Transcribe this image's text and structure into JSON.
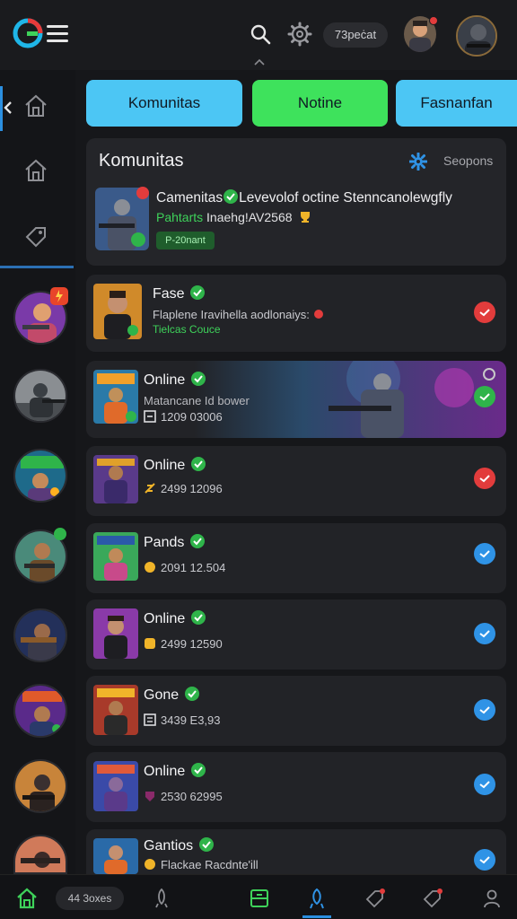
{
  "topbar": {
    "status_pill": "73peċat"
  },
  "tabs": [
    {
      "label": "Komunitas",
      "color": "#4cc6f4"
    },
    {
      "label": "Notine",
      "color": "#3ee25c"
    },
    {
      "label": "Fasnanfan",
      "color": "#4cc6f4"
    }
  ],
  "header_card": {
    "title": "Komunitas",
    "options_label": "Seopons",
    "headline": "Camenitas",
    "headline_rest": "Levevolof octine Stenncanolewgfly",
    "sub_green": "Pahtarts",
    "sub_rest": " Inaehg!AV2568",
    "tag": "P-20nant"
  },
  "rows": [
    {
      "name": "Fase",
      "subtitle": "Flaplene Iravihella aodlonaiys:",
      "extra": "Tielcas Couce",
      "status": "red"
    },
    {
      "name": "Online",
      "subtitle": "Matancane Id bower",
      "count": "1209 03006",
      "status": "green"
    },
    {
      "name": "Online",
      "subtitle": "2499 12096",
      "status": "red"
    },
    {
      "name": "Pands",
      "subtitle": "2091 12.504",
      "status": "blue"
    },
    {
      "name": "Online",
      "subtitle": "2499 12590",
      "status": "blue"
    },
    {
      "name": "Gone",
      "subtitle": "3439 E3,93",
      "status": "blue"
    },
    {
      "name": "Online",
      "subtitle": "2530 62995",
      "status": "blue"
    },
    {
      "name": "Gantios",
      "subtitle": "Flackae Racdnte'ill",
      "status": "blue"
    }
  ],
  "bottombar": {
    "pill": "44 3oxes"
  },
  "colors": {
    "accent_blue": "#2b8fe0",
    "online_green": "#3ed25a",
    "alert_red": "#e23c3c",
    "background": "#16171a"
  }
}
